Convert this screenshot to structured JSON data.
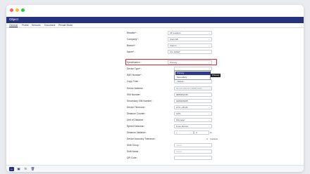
{
  "window": {
    "title": "Object"
  },
  "tabs": [
    {
      "label": "General"
    },
    {
      "label": "Profile"
    },
    {
      "label": "Sensors"
    },
    {
      "label": "Document"
    },
    {
      "label": "Private Mode"
    }
  ],
  "form": {
    "fields": [
      {
        "label": "Reseller* :",
        "value": "All resellers"
      },
      {
        "label": "Company* :",
        "value": "Clent AB"
      },
      {
        "label": "Branch* :",
        "value": "Clent A"
      },
      {
        "label": "Name* :",
        "value": "CH-JAKEY"
      },
      {
        "label": "Specification :",
        "value": "Primary"
      },
      {
        "label": "Device Type* :",
        "value": ""
      },
      {
        "label": "IMEI Number* :",
        "value": ""
      },
      {
        "label": "Copy From :",
        "value": "--Select--"
      },
      {
        "label": "Server Address :",
        "value": "53.137.246.51 / 9994(TCP)"
      },
      {
        "label": "SIM Number :",
        "value": "9865452135"
      },
      {
        "label": "Secondary SIM Number :",
        "value": "9265465465"
      },
      {
        "label": "Device Timezone :",
        "value": "UTC +05:30"
      },
      {
        "label": "Distance Counter :",
        "value": "GPS"
      },
      {
        "label": "Unit of Distance :",
        "value": "Kilometer"
      },
      {
        "label": "Speed Detection :",
        "value": "From Device"
      },
      {
        "label": "Distance Variation :",
        "value": "0"
      },
      {
        "label": "Device Accuracy Tolerance :",
        "value": ""
      },
      {
        "label": "Shift Group :",
        "value": "",
        "placeholder": "Select"
      },
      {
        "label": "Shift Name :",
        "value": "",
        "placeholder": "Select"
      },
      {
        "label": "QR Code :",
        "value": ""
      }
    ],
    "distance_variation_sign": "+",
    "distance_variation_unit": "%",
    "accuracy_tolerance_value": "0",
    "accuracy_tolerance_unit": "(meters)"
  },
  "specification_dropdown": {
    "options": [
      "Primary",
      "Secondary"
    ],
    "selected": "Primary",
    "hover_tooltip": "Primary"
  },
  "bottom_bar": {
    "icons": [
      "back-icon",
      "save-icon",
      "refresh-icon",
      "delete-icon"
    ]
  },
  "colors": {
    "accent": "#27327e",
    "highlight": "#e0262e",
    "dropdown_selected": "#2f3a8f"
  }
}
